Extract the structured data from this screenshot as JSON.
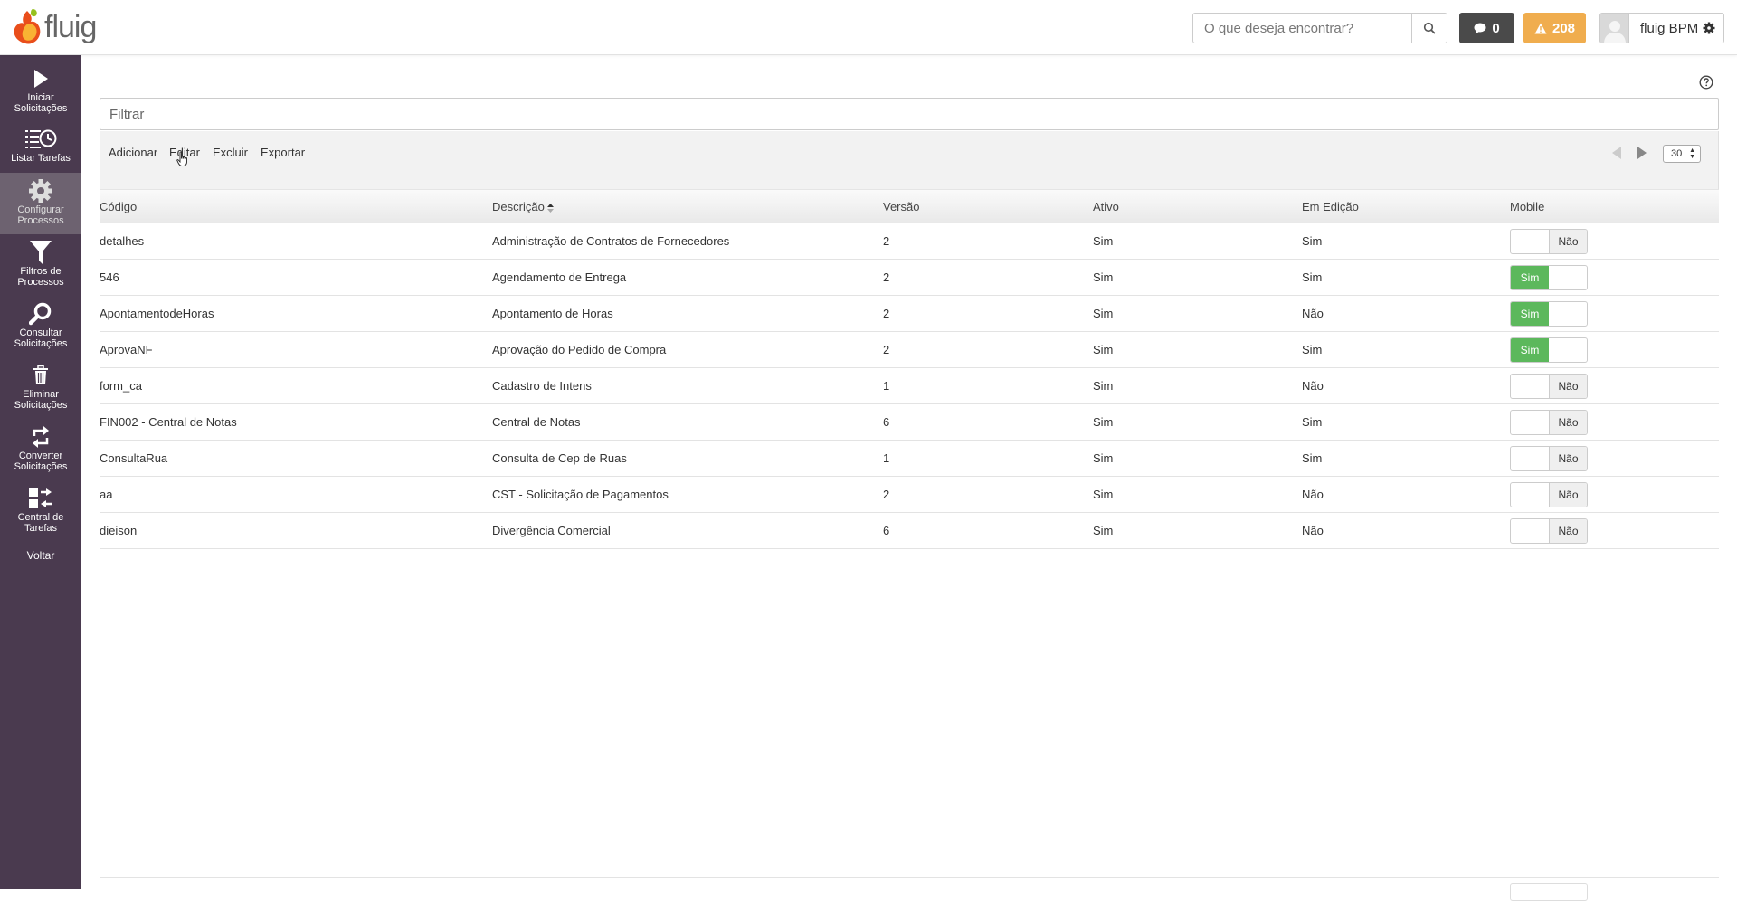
{
  "header": {
    "logo_text": "fluig",
    "search_placeholder": "O que deseja encontrar?",
    "messages_count": "0",
    "alerts_count": "208",
    "user_name": "fluig BPM"
  },
  "sidebar": {
    "items": [
      {
        "label": "Iniciar Solicitações",
        "icon": "play-icon"
      },
      {
        "label": "Listar Tarefas",
        "icon": "task-list-icon"
      },
      {
        "label": "Configurar Processos",
        "icon": "gear-icon",
        "active": true
      },
      {
        "label": "Filtros de Processos",
        "icon": "filter-icon"
      },
      {
        "label": "Consultar Solicitações",
        "icon": "search-icon"
      },
      {
        "label": "Eliminar Solicitações",
        "icon": "trash-icon"
      },
      {
        "label": "Converter Solicitações",
        "icon": "convert-icon"
      },
      {
        "label": "Central de Tarefas",
        "icon": "task-center-icon"
      }
    ],
    "back_label": "Voltar"
  },
  "filter": {
    "placeholder": "Filtrar"
  },
  "toolbar": {
    "add_label": "Adicionar",
    "edit_label": "Editar",
    "delete_label": "Excluir",
    "export_label": "Exportar",
    "page_size": "30"
  },
  "table": {
    "columns": [
      "Código",
      "Descrição",
      "Versão",
      "Ativo",
      "Em Edição",
      "Mobile"
    ],
    "rows": [
      {
        "codigo": "detalhes",
        "descricao": "Administração de Contratos de Fornecedores",
        "versao": "2",
        "ativo": "Sim",
        "edicao": "Sim",
        "mobile": "Não"
      },
      {
        "codigo": "546",
        "descricao": "Agendamento de Entrega",
        "versao": "2",
        "ativo": "Sim",
        "edicao": "Sim",
        "mobile": "Sim"
      },
      {
        "codigo": "ApontamentodeHoras",
        "descricao": "Apontamento de Horas",
        "versao": "2",
        "ativo": "Sim",
        "edicao": "Não",
        "mobile": "Sim"
      },
      {
        "codigo": "AprovaNF",
        "descricao": "Aprovação do Pedido de Compra",
        "versao": "2",
        "ativo": "Sim",
        "edicao": "Sim",
        "mobile": "Sim"
      },
      {
        "codigo": "form_ca",
        "descricao": "Cadastro de Intens",
        "versao": "1",
        "ativo": "Sim",
        "edicao": "Não",
        "mobile": "Não"
      },
      {
        "codigo": "FIN002 - Central de Notas",
        "descricao": "Central de Notas",
        "versao": "6",
        "ativo": "Sim",
        "edicao": "Sim",
        "mobile": "Não"
      },
      {
        "codigo": "ConsultaRua",
        "descricao": "Consulta de Cep de Ruas",
        "versao": "1",
        "ativo": "Sim",
        "edicao": "Sim",
        "mobile": "Não"
      },
      {
        "codigo": "aa",
        "descricao": "CST - Solicitação de Pagamentos",
        "versao": "2",
        "ativo": "Sim",
        "edicao": "Não",
        "mobile": "Não"
      },
      {
        "codigo": "dieison",
        "descricao": "Divergência Comercial",
        "versao": "6",
        "ativo": "Sim",
        "edicao": "Não",
        "mobile": "Não"
      }
    ]
  },
  "colors": {
    "sidebar_bg": "#4a3a4f",
    "sidebar_active": "#6d6270",
    "toggle_on": "#5cb85c",
    "alert": "#f0ad4e",
    "messages": "#4a4a4a"
  }
}
